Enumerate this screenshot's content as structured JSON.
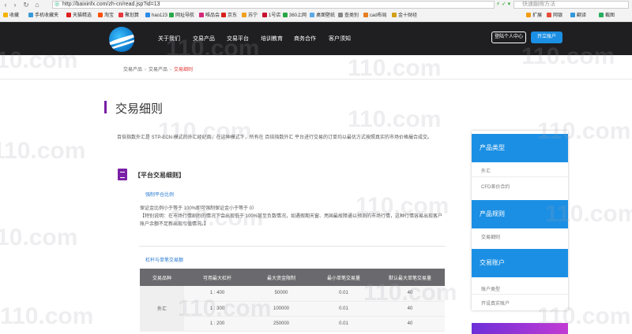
{
  "browser": {
    "url": "http://baixinfx.com/zh-cn/read.jsp?id=13",
    "search_placeholder": "快速翻牌方法",
    "bookmarks": [
      "收藏",
      "手机收藏夹",
      "天猫精选",
      "淘宝",
      "聚划算",
      "hao123",
      "网址导航",
      "唯品会",
      "京东",
      "苏宁",
      "1号店",
      "360上网",
      "桌面壁纸",
      "查类别",
      "cad布局",
      "金十财经"
    ],
    "right_tools": [
      "扩展",
      "网银",
      "翻译",
      "截图"
    ]
  },
  "header": {
    "nav": [
      "关于我们",
      "交易产品",
      "交易平台",
      "培训教育",
      "商务合作",
      "客户须知"
    ],
    "login_label": "登陆个人中心",
    "open_account_label": "开立账户"
  },
  "breadcrumb": [
    "交易产品",
    "交易产品",
    "交易细则"
  ],
  "page_title": "交易细则",
  "intro": "百倍指数外汇是 STP-ECN 模式的外汇经纪商，在这种模式下，所有在 百倍指数外汇 平台进行交易的订单均以最优方式按照真实的市场价格撮合成交。",
  "section_title": "【平台交易细则】",
  "forced_liquidation_title": "强制平仓比例",
  "forced_liquidation_rule": "保证金比例小于等于 100%即可强制保证金小于等于 0）",
  "special_note": "【特别说明：在市场行情剧烈的情况下会出现低于 100%甚至负数情况，如遇假期天窗、亮国最故障通以预测的市场行情，这种行情容易出现客户账户余额不足新出现亏值情况。】",
  "leverage_title": "杠杆与单笔交易额",
  "table": {
    "headers": [
      "交易品种",
      "可用最大杠杆",
      "最大资金限制",
      "最小单笔交易量",
      "默认最大单笔交易量"
    ],
    "group": "外汇",
    "rows": [
      [
        "1 : 400",
        "50000",
        "0.01",
        "40"
      ],
      [
        "1 : 300",
        "100000",
        "0.01",
        "40"
      ],
      [
        "1 : 200",
        "250000",
        "0.01",
        "40"
      ]
    ]
  },
  "sidebar": {
    "sections": [
      {
        "title": "产品类型",
        "items": [
          "外汇",
          "CFD差价合约"
        ]
      },
      {
        "title": "产品规则",
        "items": [
          "交易细则"
        ]
      },
      {
        "title": "交易账户",
        "items": [
          "账户类型",
          "开设真实账户"
        ]
      }
    ]
  },
  "watermark": "110.com"
}
